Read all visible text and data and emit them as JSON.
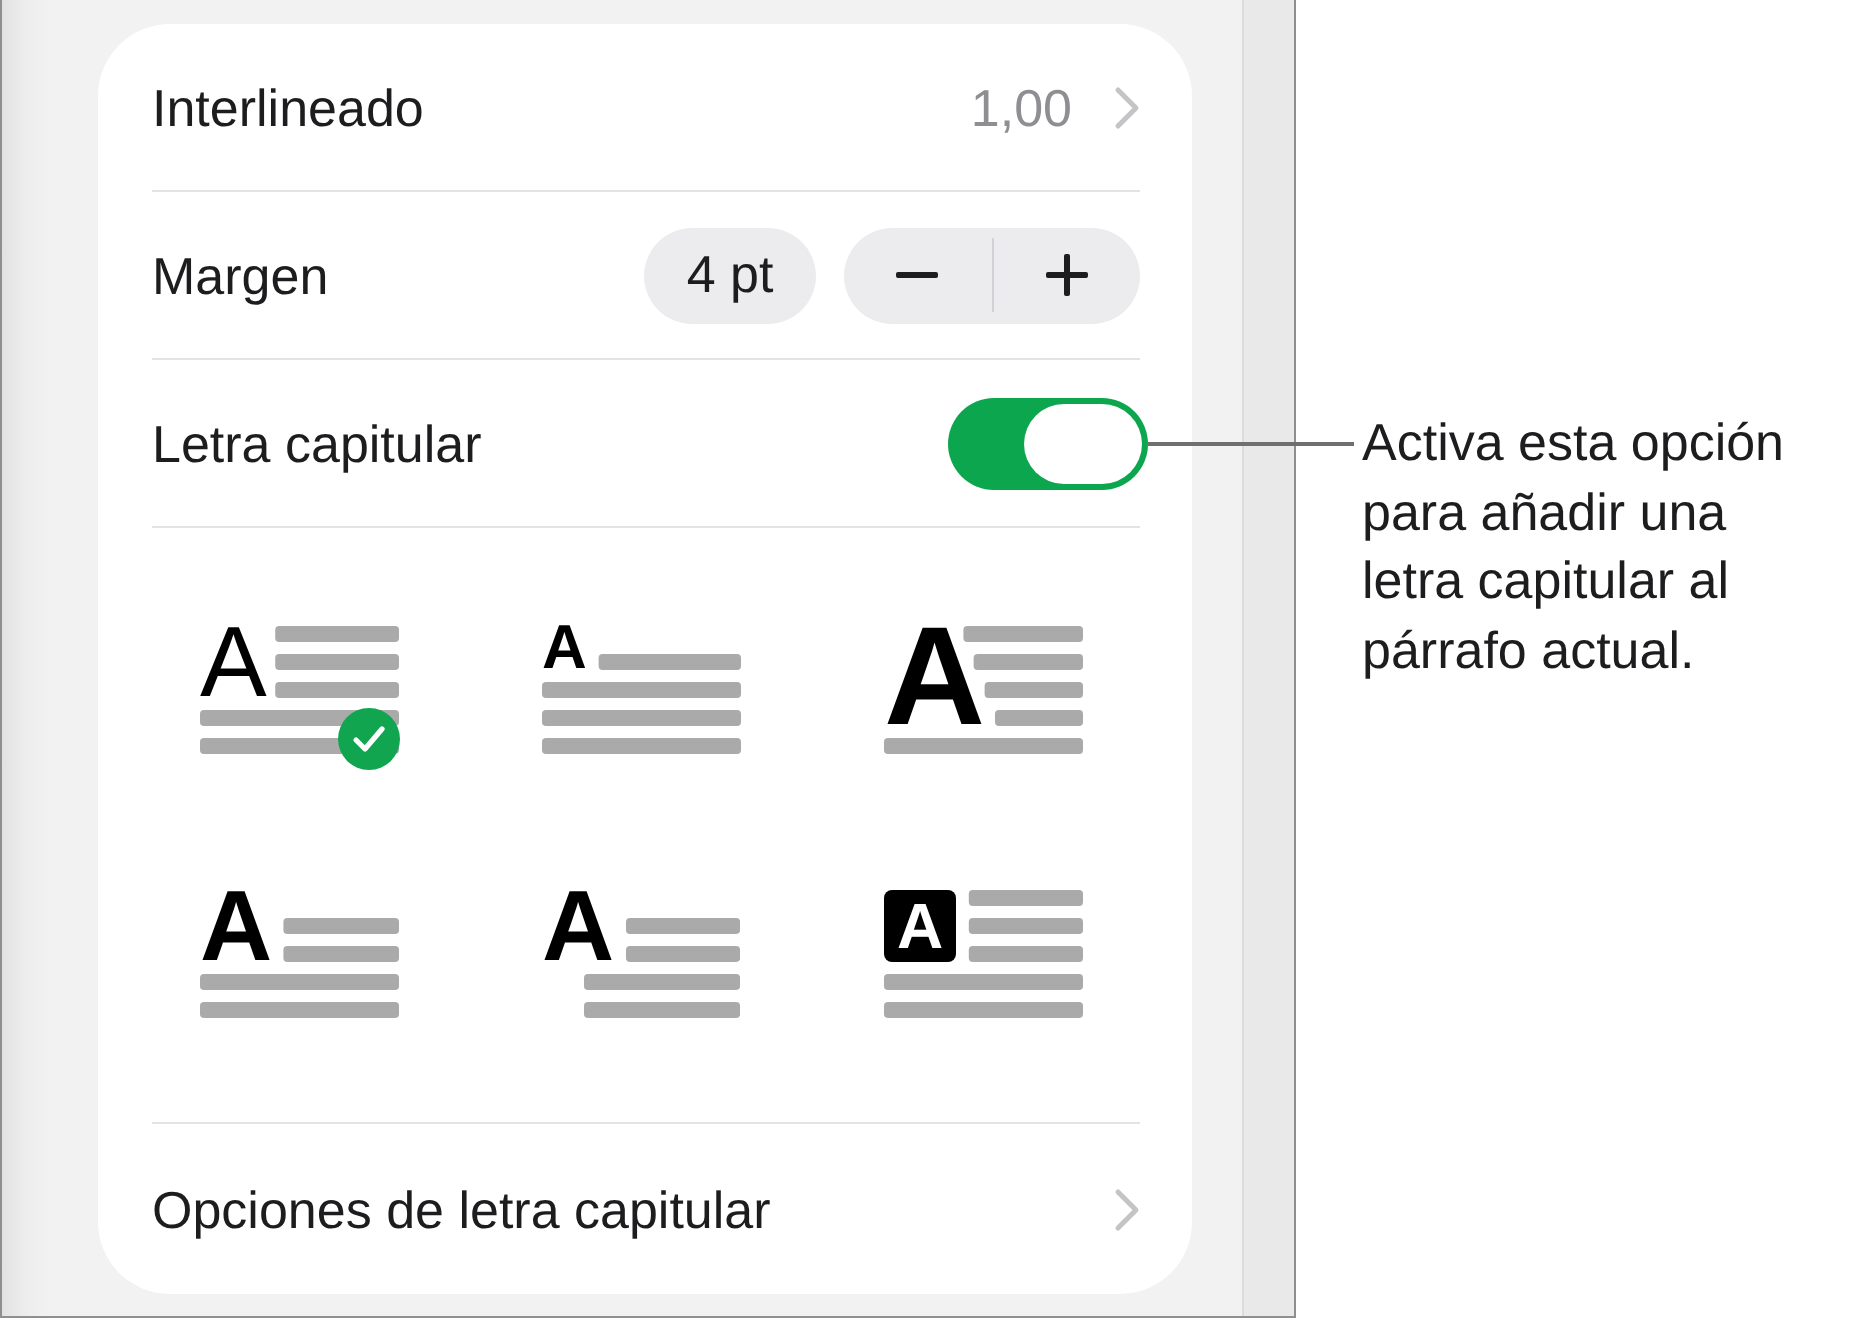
{
  "settings_rows": [
    {
      "kind": "value",
      "label": "Interlineado",
      "value": "1,00"
    },
    {
      "kind": "stepper",
      "label": "Margen",
      "value": "4 pt"
    },
    {
      "kind": "toggle",
      "label": "Letra capitular",
      "on": true
    }
  ],
  "drop_cap_styles": [
    {
      "kind": "thin",
      "letter": "A",
      "selected": true
    },
    {
      "kind": "small",
      "letter": "A",
      "selected": false
    },
    {
      "kind": "large",
      "letter": "A",
      "selected": false
    },
    {
      "kind": "bold",
      "letter": "A",
      "selected": false
    },
    {
      "kind": "hanging",
      "letter": "A",
      "selected": false
    },
    {
      "kind": "boxed",
      "letter": "A",
      "selected": false
    }
  ],
  "options_row": {
    "label": "Opciones de letra capitular"
  },
  "callout": {
    "text": "Activa esta opción para añadir una letra capitular al párrafo actual."
  }
}
